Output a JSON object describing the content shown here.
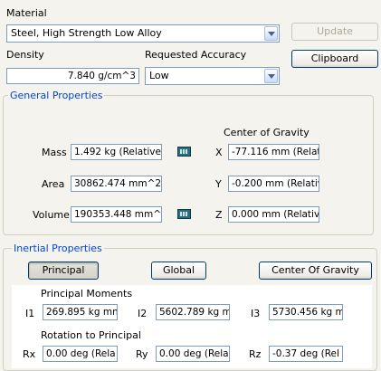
{
  "material": {
    "label": "Material",
    "selected": "Steel, High Strength Low Alloy",
    "update_label": "Update"
  },
  "density": {
    "label": "Density",
    "value": "7.840 g/cm^3"
  },
  "accuracy": {
    "label": "Requested Accuracy",
    "selected": "Low"
  },
  "clipboard_label": "Clipboard",
  "general": {
    "title": "General Properties",
    "cog_label": "Center of Gravity",
    "mass_label": "Mass",
    "mass_value": "1.492 kg (Relative",
    "area_label": "Area",
    "area_value": "30862.474 mm^2 (",
    "volume_label": "Volume",
    "volume_value": "190353.448 mm^3",
    "x_label": "X",
    "x_value": "-77.116 mm (Relat",
    "y_label": "Y",
    "y_value": "-0.200 mm (Relativ",
    "z_label": "Z",
    "z_value": "0.000 mm (Relative"
  },
  "inertial": {
    "title": "Inertial Properties",
    "tabs": {
      "principal": "Principal",
      "global": "Global",
      "cog": "Center Of Gravity"
    },
    "moments_label": "Principal Moments",
    "i1_label": "I1",
    "i1_value": "269.895 kg mm",
    "i2_label": "I2",
    "i2_value": "5602.789 kg m",
    "i3_label": "I3",
    "i3_value": "5730.456 kg m",
    "rotation_label": "Rotation to Principal",
    "rx_label": "Rx",
    "rx_value": "0.00 deg (Rela",
    "ry_label": "Ry",
    "ry_value": "0.00 deg (Rela",
    "rz_label": "Rz",
    "rz_value": "-0.37 deg (Rel"
  },
  "icons": {
    "combo_arrow": "chevron-down-icon",
    "calculator": "calculator-icon"
  }
}
